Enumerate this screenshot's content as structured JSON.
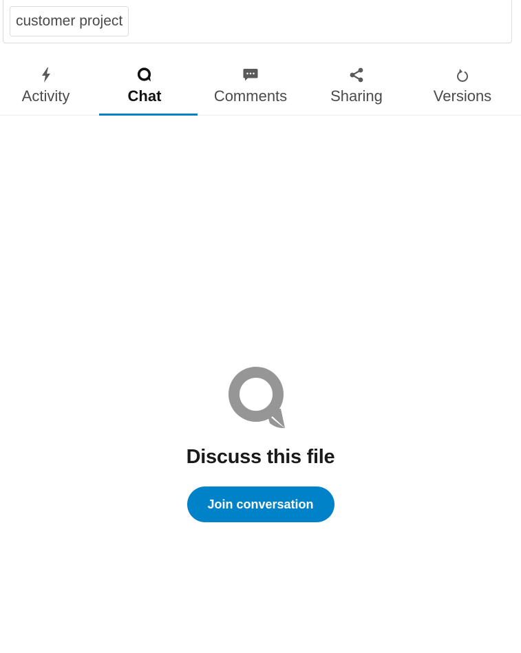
{
  "tags": {
    "chip_label": "customer project"
  },
  "tabs": [
    {
      "label": "Activity",
      "icon": "lightning-icon"
    },
    {
      "label": "Chat",
      "icon": "talk-icon",
      "active": true
    },
    {
      "label": "Comments",
      "icon": "comment-icon"
    },
    {
      "label": "Sharing",
      "icon": "share-icon"
    },
    {
      "label": "Versions",
      "icon": "history-icon"
    }
  ],
  "empty_state": {
    "icon": "talk-icon",
    "title": "Discuss this file",
    "button_label": "Join conversation"
  },
  "colors": {
    "accent": "#0082c9",
    "icon_gray": "#969696"
  }
}
